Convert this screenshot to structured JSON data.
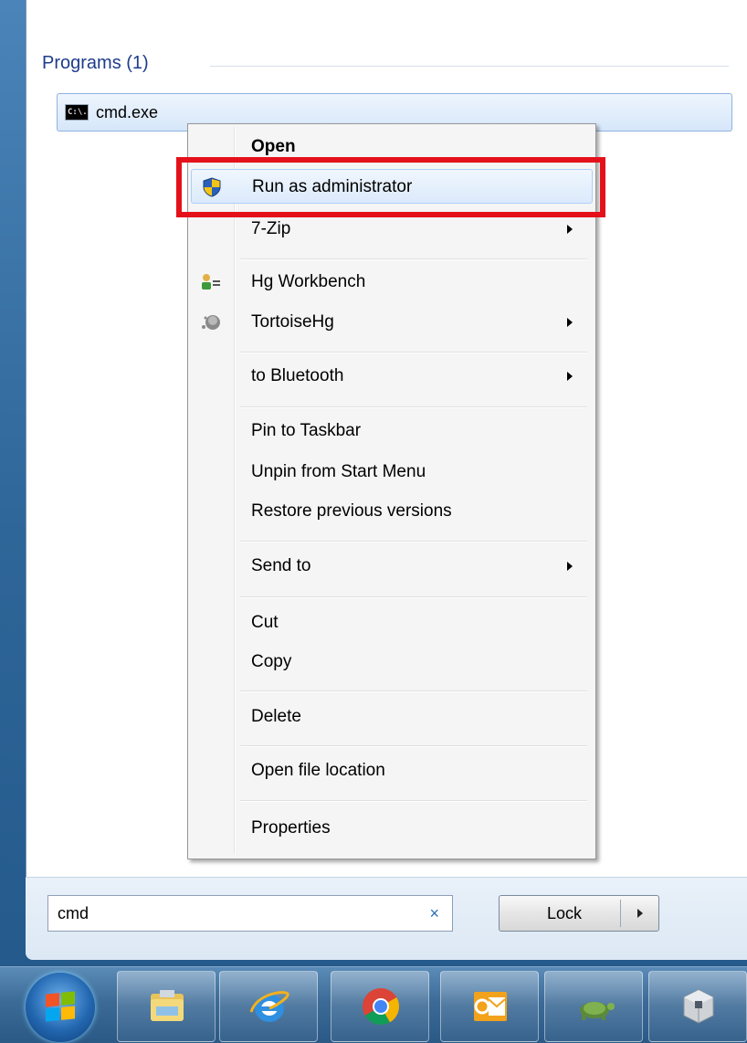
{
  "programs": {
    "header": "Programs (1)",
    "result": {
      "label": "cmd.exe",
      "icon": "cmd-icon",
      "icon_text": "C:\\."
    }
  },
  "context_menu": {
    "items": [
      {
        "label": "Open",
        "bold": true
      },
      {
        "label": "Run as administrator",
        "icon": "uac-shield-icon",
        "highlighted": true
      },
      {
        "label": "7-Zip",
        "submenu": true
      },
      {
        "label": "Hg Workbench",
        "icon": "hg-workbench-icon"
      },
      {
        "label": "TortoiseHg",
        "icon": "tortoisehg-icon",
        "submenu": true
      },
      {
        "label": "to Bluetooth",
        "submenu": true
      },
      {
        "label": "Pin to Taskbar"
      },
      {
        "label": "Unpin from Start Menu"
      },
      {
        "label": "Restore previous versions"
      },
      {
        "label": "Send to",
        "submenu": true
      },
      {
        "label": "Cut"
      },
      {
        "label": "Copy"
      },
      {
        "label": "Delete"
      },
      {
        "label": "Open file location"
      },
      {
        "label": "Properties"
      }
    ]
  },
  "search": {
    "value": "cmd",
    "clear_symbol": "×"
  },
  "lock_button": {
    "label": "Lock"
  },
  "taskbar": {
    "start_icon": "windows-orb-icon",
    "pinned": [
      {
        "name": "file-explorer-icon"
      },
      {
        "name": "internet-explorer-icon"
      },
      {
        "name": "chrome-icon"
      },
      {
        "name": "outlook-icon"
      },
      {
        "name": "tortoise-icon"
      },
      {
        "name": "virtualbox-icon"
      }
    ]
  },
  "colors": {
    "highlight_border": "#e4111b",
    "header_text": "#1e3c8c",
    "taskbar": "#3c6b97"
  }
}
